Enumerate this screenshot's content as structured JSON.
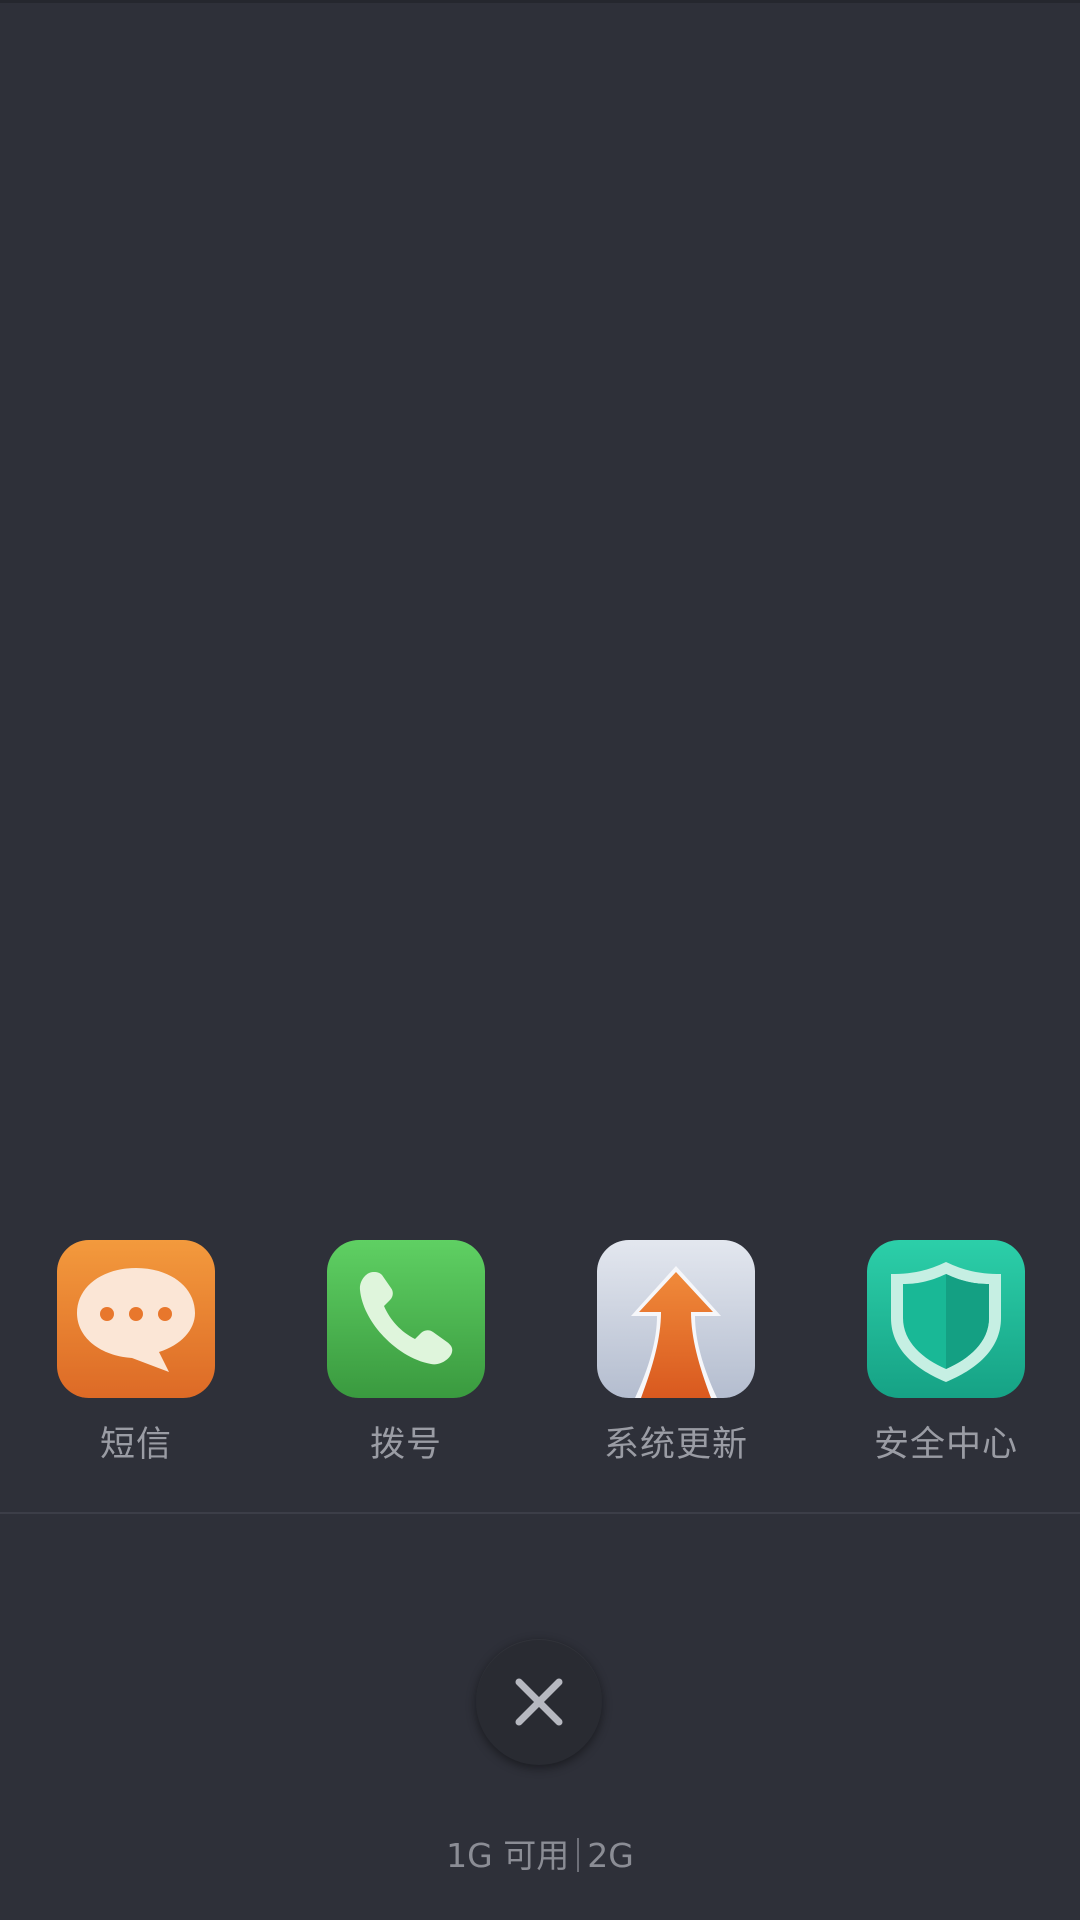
{
  "dock": {
    "apps": [
      {
        "label": "短信",
        "icon": "message-bubble-icon"
      },
      {
        "label": "拨号",
        "icon": "phone-handset-icon"
      },
      {
        "label": "系统更新",
        "icon": "update-arrow-icon"
      },
      {
        "label": "安全中心",
        "icon": "shield-icon"
      }
    ]
  },
  "memory": {
    "available": "1G 可用",
    "total": "2G"
  },
  "colors": {
    "background": "#2e3039",
    "label": "#9a9ca4",
    "messages_orange": "#e8772c",
    "phone_green": "#4cbf4f",
    "update_gray": "#cfd5e2",
    "security_teal": "#1fb89a"
  }
}
